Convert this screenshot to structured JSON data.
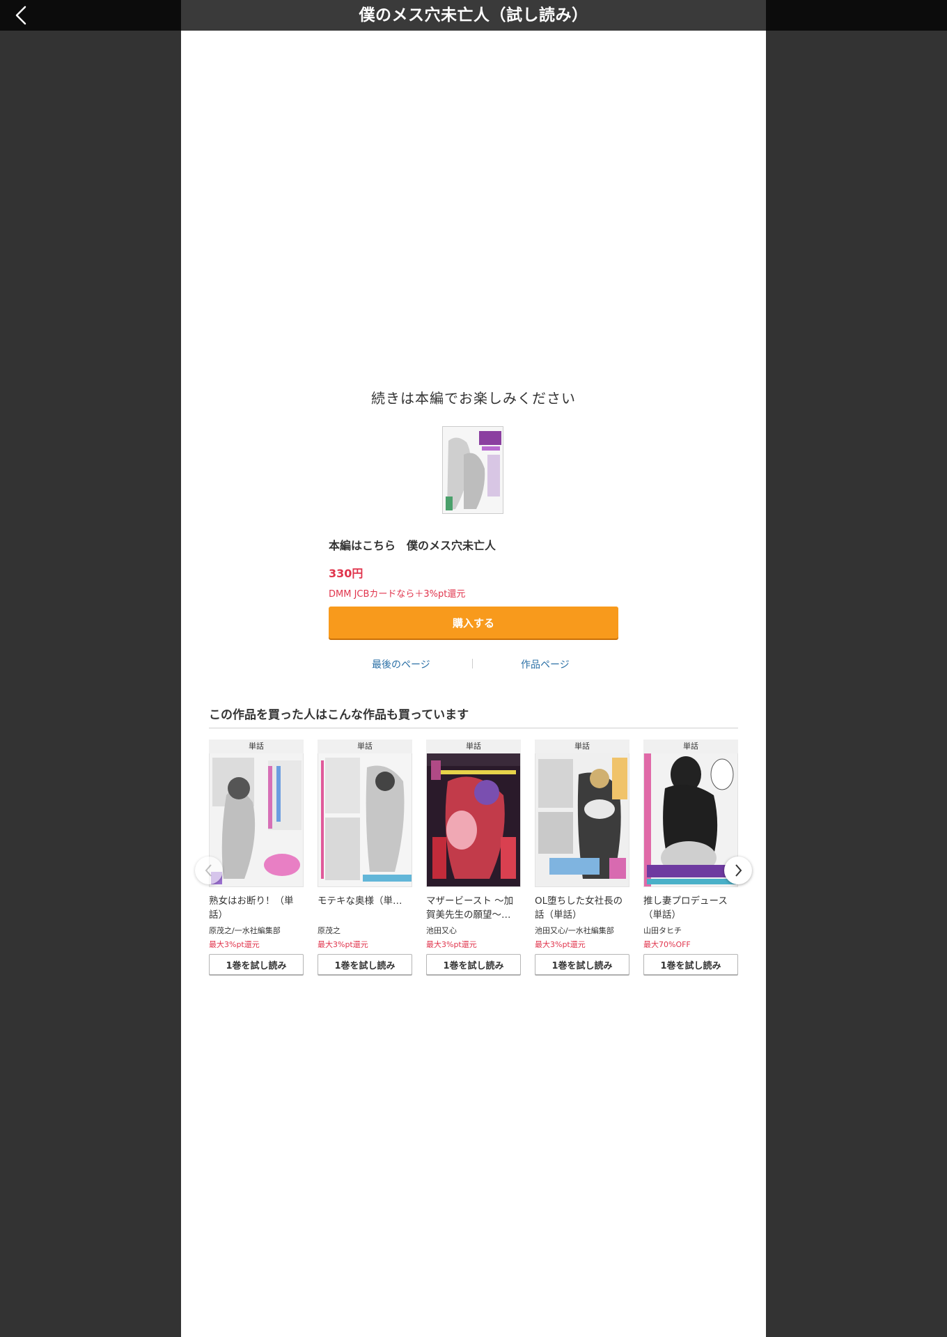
{
  "header": {
    "title": "僕のメス穴未亡人（試し読み）"
  },
  "end_panel": {
    "message": "続きは本編でお楽しみください",
    "buy_title": "本編はこちら　僕のメス穴未亡人",
    "price": "330円",
    "campaign": "DMM JCBカードなら＋3%pt還元",
    "buy_button": "購入する",
    "last_page_link": "最後のページ",
    "product_page_link": "作品ページ"
  },
  "recommend": {
    "heading": "この作品を買った人はこんな作品も買っています",
    "items": [
      {
        "badge": "単話",
        "title": "熟女はお断り！（単話）",
        "author": "原茂之/一水社編集部",
        "point": "最大3%pt還元",
        "trial": "1巻を試し読み"
      },
      {
        "badge": "単話",
        "title": "モテキな奥様（単…",
        "author": "原茂之",
        "point": "最大3%pt還元",
        "trial": "1巻を試し読み"
      },
      {
        "badge": "単話",
        "title": "マザービースト 〜加賀美先生の願望〜…",
        "author": "池田又心",
        "point": "最大3%pt還元",
        "trial": "1巻を試し読み"
      },
      {
        "badge": "単話",
        "title": "OL堕ちした女社長の話（単話）",
        "author": "池田又心/一水社編集部",
        "point": "最大3%pt還元",
        "trial": "1巻を試し読み"
      },
      {
        "badge": "単話",
        "title": "推し妻プロデュース（単話）",
        "author": "山田タヒチ",
        "point": "最大70%OFF",
        "trial": "1巻を試し読み"
      }
    ]
  },
  "colors": {
    "accent": "#f89a1c",
    "price": "#e0344c",
    "link": "#2b70a6",
    "backdrop": "#333333"
  },
  "icons": {
    "back": "chevron-left-icon",
    "prev": "chevron-left-icon",
    "next": "chevron-right-icon"
  }
}
